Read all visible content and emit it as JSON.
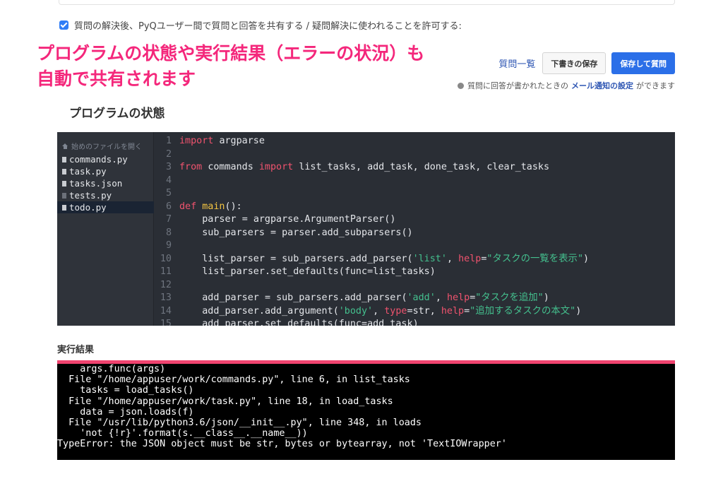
{
  "consent": {
    "checked": true,
    "text": "質問の解決後、PyQユーザー間で質問と回答を共有する / 疑問解決に使われることを許可する:"
  },
  "promo": {
    "line1": "プログラムの状態や実行結果（エラーの状況）も",
    "line2": "自動で共有されます"
  },
  "actions": {
    "question_list": "質問一覧",
    "save_draft": "下書きの保存",
    "save_and_ask": "保存して質問"
  },
  "notice": {
    "before": "質問に回答が書かれたときの",
    "link": "メール通知の設定",
    "after": "ができます"
  },
  "program_state": {
    "title": "プログラムの状態",
    "tree_header": "始めのファイルを開く",
    "files": [
      {
        "name": "commands.py",
        "active": false
      },
      {
        "name": "task.py",
        "active": false
      },
      {
        "name": "tasks.json",
        "active": false
      },
      {
        "name": "tests.py",
        "active": false
      },
      {
        "name": "todo.py",
        "active": true
      }
    ],
    "code_lines": [
      {
        "n": "1",
        "text": "import argparse"
      },
      {
        "n": "2",
        "text": ""
      },
      {
        "n": "3",
        "text": "from commands import list_tasks, add_task, done_task, clear_tasks"
      },
      {
        "n": "4",
        "text": ""
      },
      {
        "n": "5",
        "text": ""
      },
      {
        "n": "6",
        "text": "def main():"
      },
      {
        "n": "7",
        "text": "    parser = argparse.ArgumentParser()"
      },
      {
        "n": "8",
        "text": "    sub_parsers = parser.add_subparsers()"
      },
      {
        "n": "9",
        "text": ""
      },
      {
        "n": "10",
        "text": "    list_parser = sub_parsers.add_parser('list', help=\"タスクの一覧を表示\")"
      },
      {
        "n": "11",
        "text": "    list_parser.set_defaults(func=list_tasks)"
      },
      {
        "n": "12",
        "text": ""
      },
      {
        "n": "13",
        "text": "    add_parser = sub_parsers.add_parser('add', help=\"タスクを追加\")"
      },
      {
        "n": "14",
        "text": "    add_parser.add_argument('body', type=str, help=\"追加するタスクの本文\")"
      },
      {
        "n": "15",
        "text": "    add_parser.set_defaults(func=add_task)"
      }
    ]
  },
  "execution_result": {
    "title": "実行結果",
    "lines": [
      "    args.func(args)",
      "  File \"/home/appuser/work/commands.py\", line 6, in list_tasks",
      "    tasks = load_tasks()",
      "  File \"/home/appuser/work/task.py\", line 18, in load_tasks",
      "    data = json.loads(f)",
      "  File \"/usr/lib/python3.6/json/__init__.py\", line 348, in loads",
      "    'not {!r}'.format(s.__class__.__name__))",
      "TypeError: the JSON object must be str, bytes or bytearray, not 'TextIOWrapper'"
    ]
  },
  "colors": {
    "promo": "#f4277b",
    "primary_button": "#2b6fe8",
    "terminal_accent": "#f0436f",
    "keyword": "#f0536e",
    "string": "#44c08e"
  }
}
